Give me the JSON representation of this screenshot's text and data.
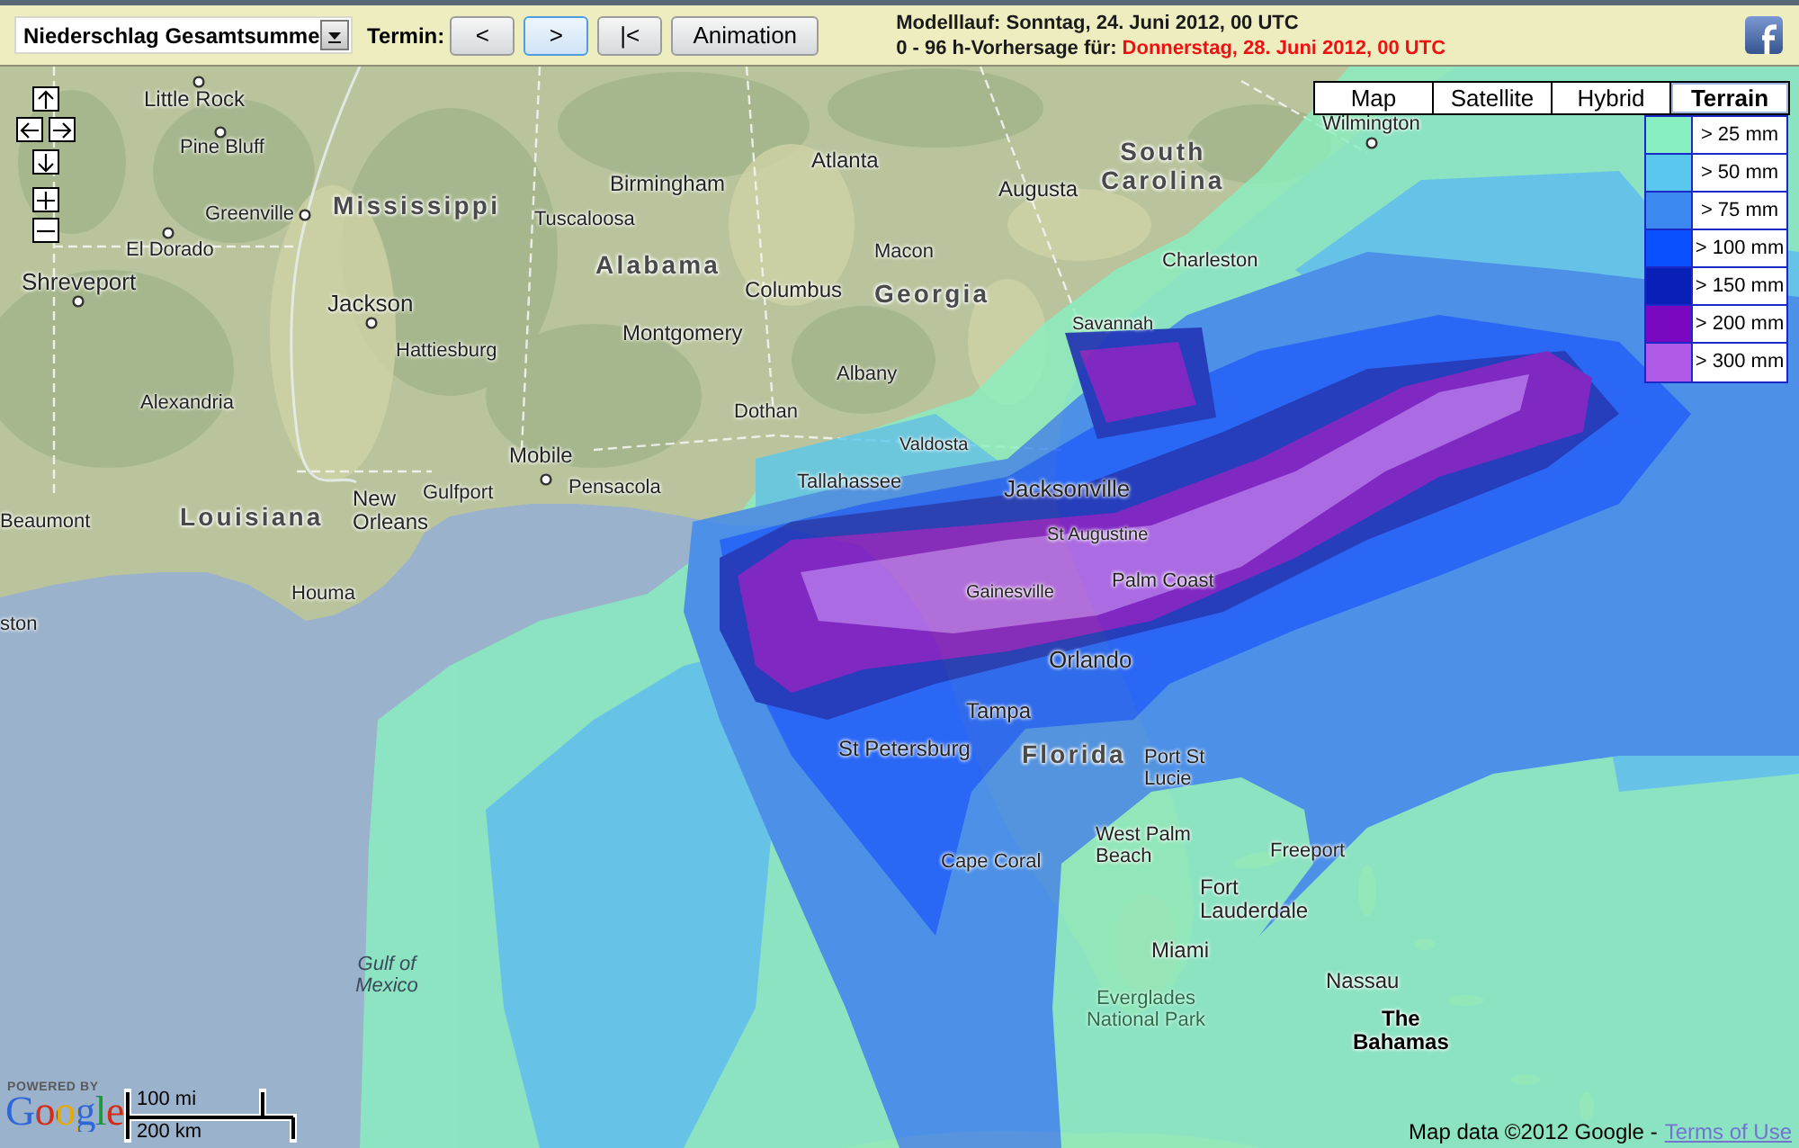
{
  "toolbar": {
    "product_dropdown": {
      "value": "Niederschlag Gesamtsumme"
    },
    "termin_label": "Termin:",
    "step_buttons": [
      {
        "label": "<",
        "focused": false
      },
      {
        "label": ">",
        "focused": true
      },
      {
        "label": "|<",
        "focused": false
      }
    ],
    "animation_button": "Animation",
    "model_run": "Modelllauf: Sonntag, 24. Juni 2012, 00 UTC",
    "forecast_label": "0 - 96 h-Vorhersage für:",
    "forecast_date": "Donnerstag, 28. Juni 2012, 00 UTC"
  },
  "map": {
    "map_types": [
      {
        "label": "Map",
        "selected": false
      },
      {
        "label": "Satellite",
        "selected": false
      },
      {
        "label": "Hybrid",
        "selected": false
      },
      {
        "label": "Terrain",
        "selected": true
      }
    ],
    "legend": [
      {
        "label": "> 25 mm",
        "color": "#88f0c0"
      },
      {
        "label": "> 50 mm",
        "color": "#5ac8ee"
      },
      {
        "label": "> 75 mm",
        "color": "#3b88ee"
      },
      {
        "label": "> 100 mm",
        "color": "#0a50ff"
      },
      {
        "label": "> 150 mm",
        "color": "#0820b8"
      },
      {
        "label": "> 200 mm",
        "color": "#7a08c0"
      },
      {
        "label": "> 300 mm",
        "color": "#b05ae8"
      }
    ],
    "labels": [
      {
        "text": "Little Rock",
        "kind": "city"
      },
      {
        "text": "Wilmington",
        "kind": "city"
      },
      {
        "text": "Pine Bluff",
        "kind": "city"
      },
      {
        "text": "Atlanta",
        "kind": "city"
      },
      {
        "text": "Birmingham",
        "kind": "city"
      },
      {
        "text": "Augusta",
        "kind": "city"
      },
      {
        "text": "South Carolina",
        "kind": "state"
      },
      {
        "text": "Greenville",
        "kind": "city"
      },
      {
        "text": "Mississippi",
        "kind": "state"
      },
      {
        "text": "Tuscaloosa",
        "kind": "city"
      },
      {
        "text": "El Dorado",
        "kind": "city"
      },
      {
        "text": "Alabama",
        "kind": "state"
      },
      {
        "text": "Macon",
        "kind": "city"
      },
      {
        "text": "Charleston",
        "kind": "city"
      },
      {
        "text": "Shreveport",
        "kind": "city"
      },
      {
        "text": "Jackson",
        "kind": "city"
      },
      {
        "text": "Columbus",
        "kind": "city"
      },
      {
        "text": "Georgia",
        "kind": "state"
      },
      {
        "text": "Montgomery",
        "kind": "city"
      },
      {
        "text": "Savannah",
        "kind": "city"
      },
      {
        "text": "Hattiesburg",
        "kind": "city"
      },
      {
        "text": "Albany",
        "kind": "city"
      },
      {
        "text": "Alexandria",
        "kind": "city"
      },
      {
        "text": "Dothan",
        "kind": "city"
      },
      {
        "text": "Mobile",
        "kind": "city"
      },
      {
        "text": "Valdosta",
        "kind": "city"
      },
      {
        "text": "Gulfport",
        "kind": "city"
      },
      {
        "text": "Pensacola",
        "kind": "city"
      },
      {
        "text": "Tallahassee",
        "kind": "city"
      },
      {
        "text": "Jacksonville",
        "kind": "city"
      },
      {
        "text": "Beaumont",
        "kind": "city"
      },
      {
        "text": "Louisiana",
        "kind": "state"
      },
      {
        "text": "New Orleans",
        "kind": "city"
      },
      {
        "text": "St Augustine",
        "kind": "city"
      },
      {
        "text": "Houma",
        "kind": "city"
      },
      {
        "text": "Gainesville",
        "kind": "city"
      },
      {
        "text": "Palm Coast",
        "kind": "city"
      },
      {
        "text": "ston",
        "kind": "city"
      },
      {
        "text": "Orlando",
        "kind": "city"
      },
      {
        "text": "Tampa",
        "kind": "city"
      },
      {
        "text": "St Petersburg",
        "kind": "city"
      },
      {
        "text": "Florida",
        "kind": "state"
      },
      {
        "text": "Port St Lucie",
        "kind": "city"
      },
      {
        "text": "Cape Coral",
        "kind": "city"
      },
      {
        "text": "West Palm Beach",
        "kind": "city"
      },
      {
        "text": "Freeport",
        "kind": "city"
      },
      {
        "text": "Fort Lauderdale",
        "kind": "city"
      },
      {
        "text": "Miami",
        "kind": "city"
      },
      {
        "text": "Gulf of Mexico",
        "kind": "water"
      },
      {
        "text": "Nassau",
        "kind": "city"
      },
      {
        "text": "Everglades National Park",
        "kind": "park"
      },
      {
        "text": "The Bahamas",
        "kind": "country"
      }
    ],
    "powered_by": "POWERED BY",
    "logo": "Google",
    "scale": {
      "miles": "100 mi",
      "kilometers": "200 km"
    },
    "attribution": "Map data ©2012 Google -",
    "terms_link": "Terms of Use"
  }
}
